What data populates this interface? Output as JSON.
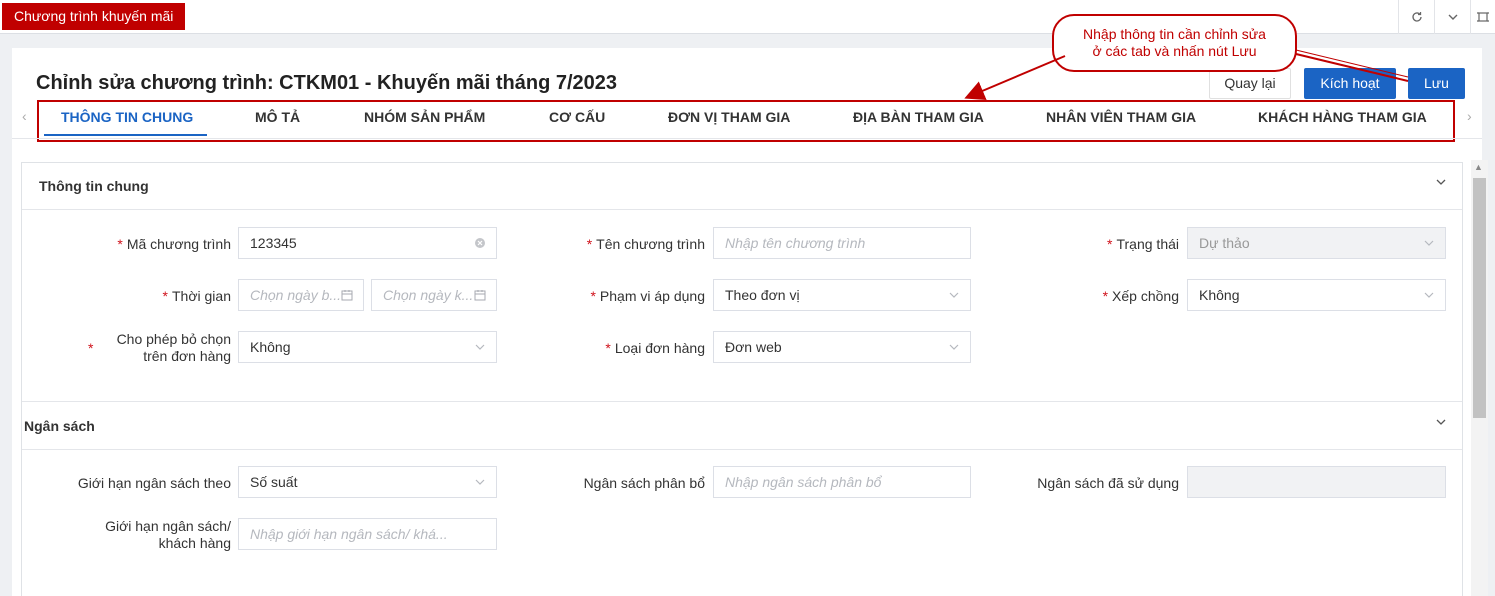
{
  "app_tab": {
    "label": "Chương trình khuyến mãi"
  },
  "topbar": {
    "refresh_icon": "refresh-icon",
    "collapse_icon": "chevron-down-icon",
    "fullscreen_icon": "fullscreen-icon"
  },
  "page": {
    "title": "Chỉnh sửa chương trình: CTKM01 - Khuyến mãi tháng 7/2023"
  },
  "actions": {
    "back": "Quay lại",
    "activate": "Kích hoạt",
    "save": "Lưu"
  },
  "tabs": [
    {
      "label": "THÔNG TIN CHUNG",
      "active": true
    },
    {
      "label": "MÔ TẢ"
    },
    {
      "label": "NHÓM SẢN PHẨM"
    },
    {
      "label": "CƠ CẤU"
    },
    {
      "label": "ĐƠN VỊ THAM GIA"
    },
    {
      "label": "ĐỊA BÀN THAM GIA"
    },
    {
      "label": "NHÂN VIÊN THAM GIA"
    },
    {
      "label": "KHÁCH HÀNG THAM GIA"
    }
  ],
  "callout": {
    "line1": "Nhập thông tin cần chỉnh sửa",
    "line2": "ở các tab và nhấn nút Lưu"
  },
  "general": {
    "title": "Thông tin chung",
    "program_code": {
      "label": "Mã chương trình",
      "value": "123345"
    },
    "program_name": {
      "label": "Tên chương trình",
      "placeholder": "Nhập tên chương trình"
    },
    "status": {
      "label": "Trạng thái",
      "value": "Dự thảo"
    },
    "time": {
      "label": "Thời gian",
      "start_placeholder": "Chọn ngày b...",
      "end_placeholder": "Chọn ngày k..."
    },
    "scope": {
      "label": "Phạm vi áp dụng",
      "value": "Theo đơn vị"
    },
    "stacking": {
      "label": "Xếp chồng",
      "value": "Không"
    },
    "allow_deselect": {
      "label_line1": "Cho phép bỏ chọn",
      "label_line2": "trên đơn hàng",
      "value": "Không"
    },
    "order_type": {
      "label": "Loại đơn hàng",
      "value": "Đơn web"
    }
  },
  "budget": {
    "title": "Ngân sách",
    "limit_by": {
      "label": "Giới hạn ngân sách theo",
      "value": "Số suất"
    },
    "allocated": {
      "label": "Ngân sách phân bổ",
      "placeholder": "Nhập ngân sách phân bổ"
    },
    "used": {
      "label": "Ngân sách đã sử dụng",
      "value": ""
    },
    "limit_per_customer": {
      "label_line1": "Giới hạn ngân sách/",
      "label_line2": "khách hàng",
      "placeholder": "Nhập giới hạn ngân sách/ khá..."
    }
  },
  "colors": {
    "accent": "#1b64c4",
    "brand_red": "#c00000",
    "required": "#d0121b"
  }
}
